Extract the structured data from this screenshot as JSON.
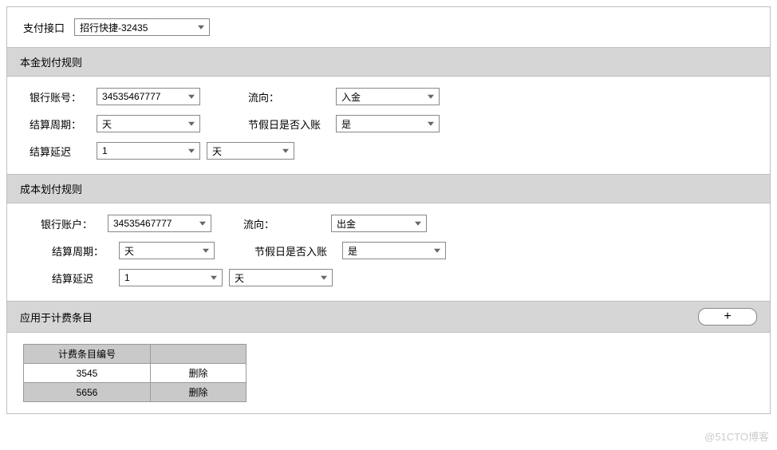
{
  "top": {
    "pay_interface_label": "支付接口",
    "pay_interface_value": "招行快捷-32435"
  },
  "section1": {
    "title": "本金划付规则",
    "bank_account_label": "银行账号：",
    "bank_account_value": "34535467777",
    "flow_label": "流向：",
    "flow_value": "入金",
    "settle_cycle_label": "结算周期：",
    "settle_cycle_value": "天",
    "holiday_label": "节假日是否入账",
    "holiday_value": "是",
    "settle_delay_label": "结算延迟",
    "settle_delay_num": "1",
    "settle_delay_unit": "天"
  },
  "section2": {
    "title": "成本划付规则",
    "bank_account_label": "银行账户：",
    "bank_account_value": "34535467777",
    "flow_label": "流向：",
    "flow_value": "出金",
    "settle_cycle_label": "结算周期：",
    "settle_cycle_value": "天",
    "holiday_label": "节假日是否入账",
    "holiday_value": "是",
    "settle_delay_label": "结算延迟",
    "settle_delay_num": "1",
    "settle_delay_unit": "天"
  },
  "apply": {
    "title": "应用于计费条目",
    "add_label": "+",
    "col_id": "计费条目编号",
    "col_action": "",
    "delete_label": "删除",
    "rows": [
      {
        "id": "3545"
      },
      {
        "id": "5656"
      }
    ]
  },
  "watermark": "@51CTO博客"
}
